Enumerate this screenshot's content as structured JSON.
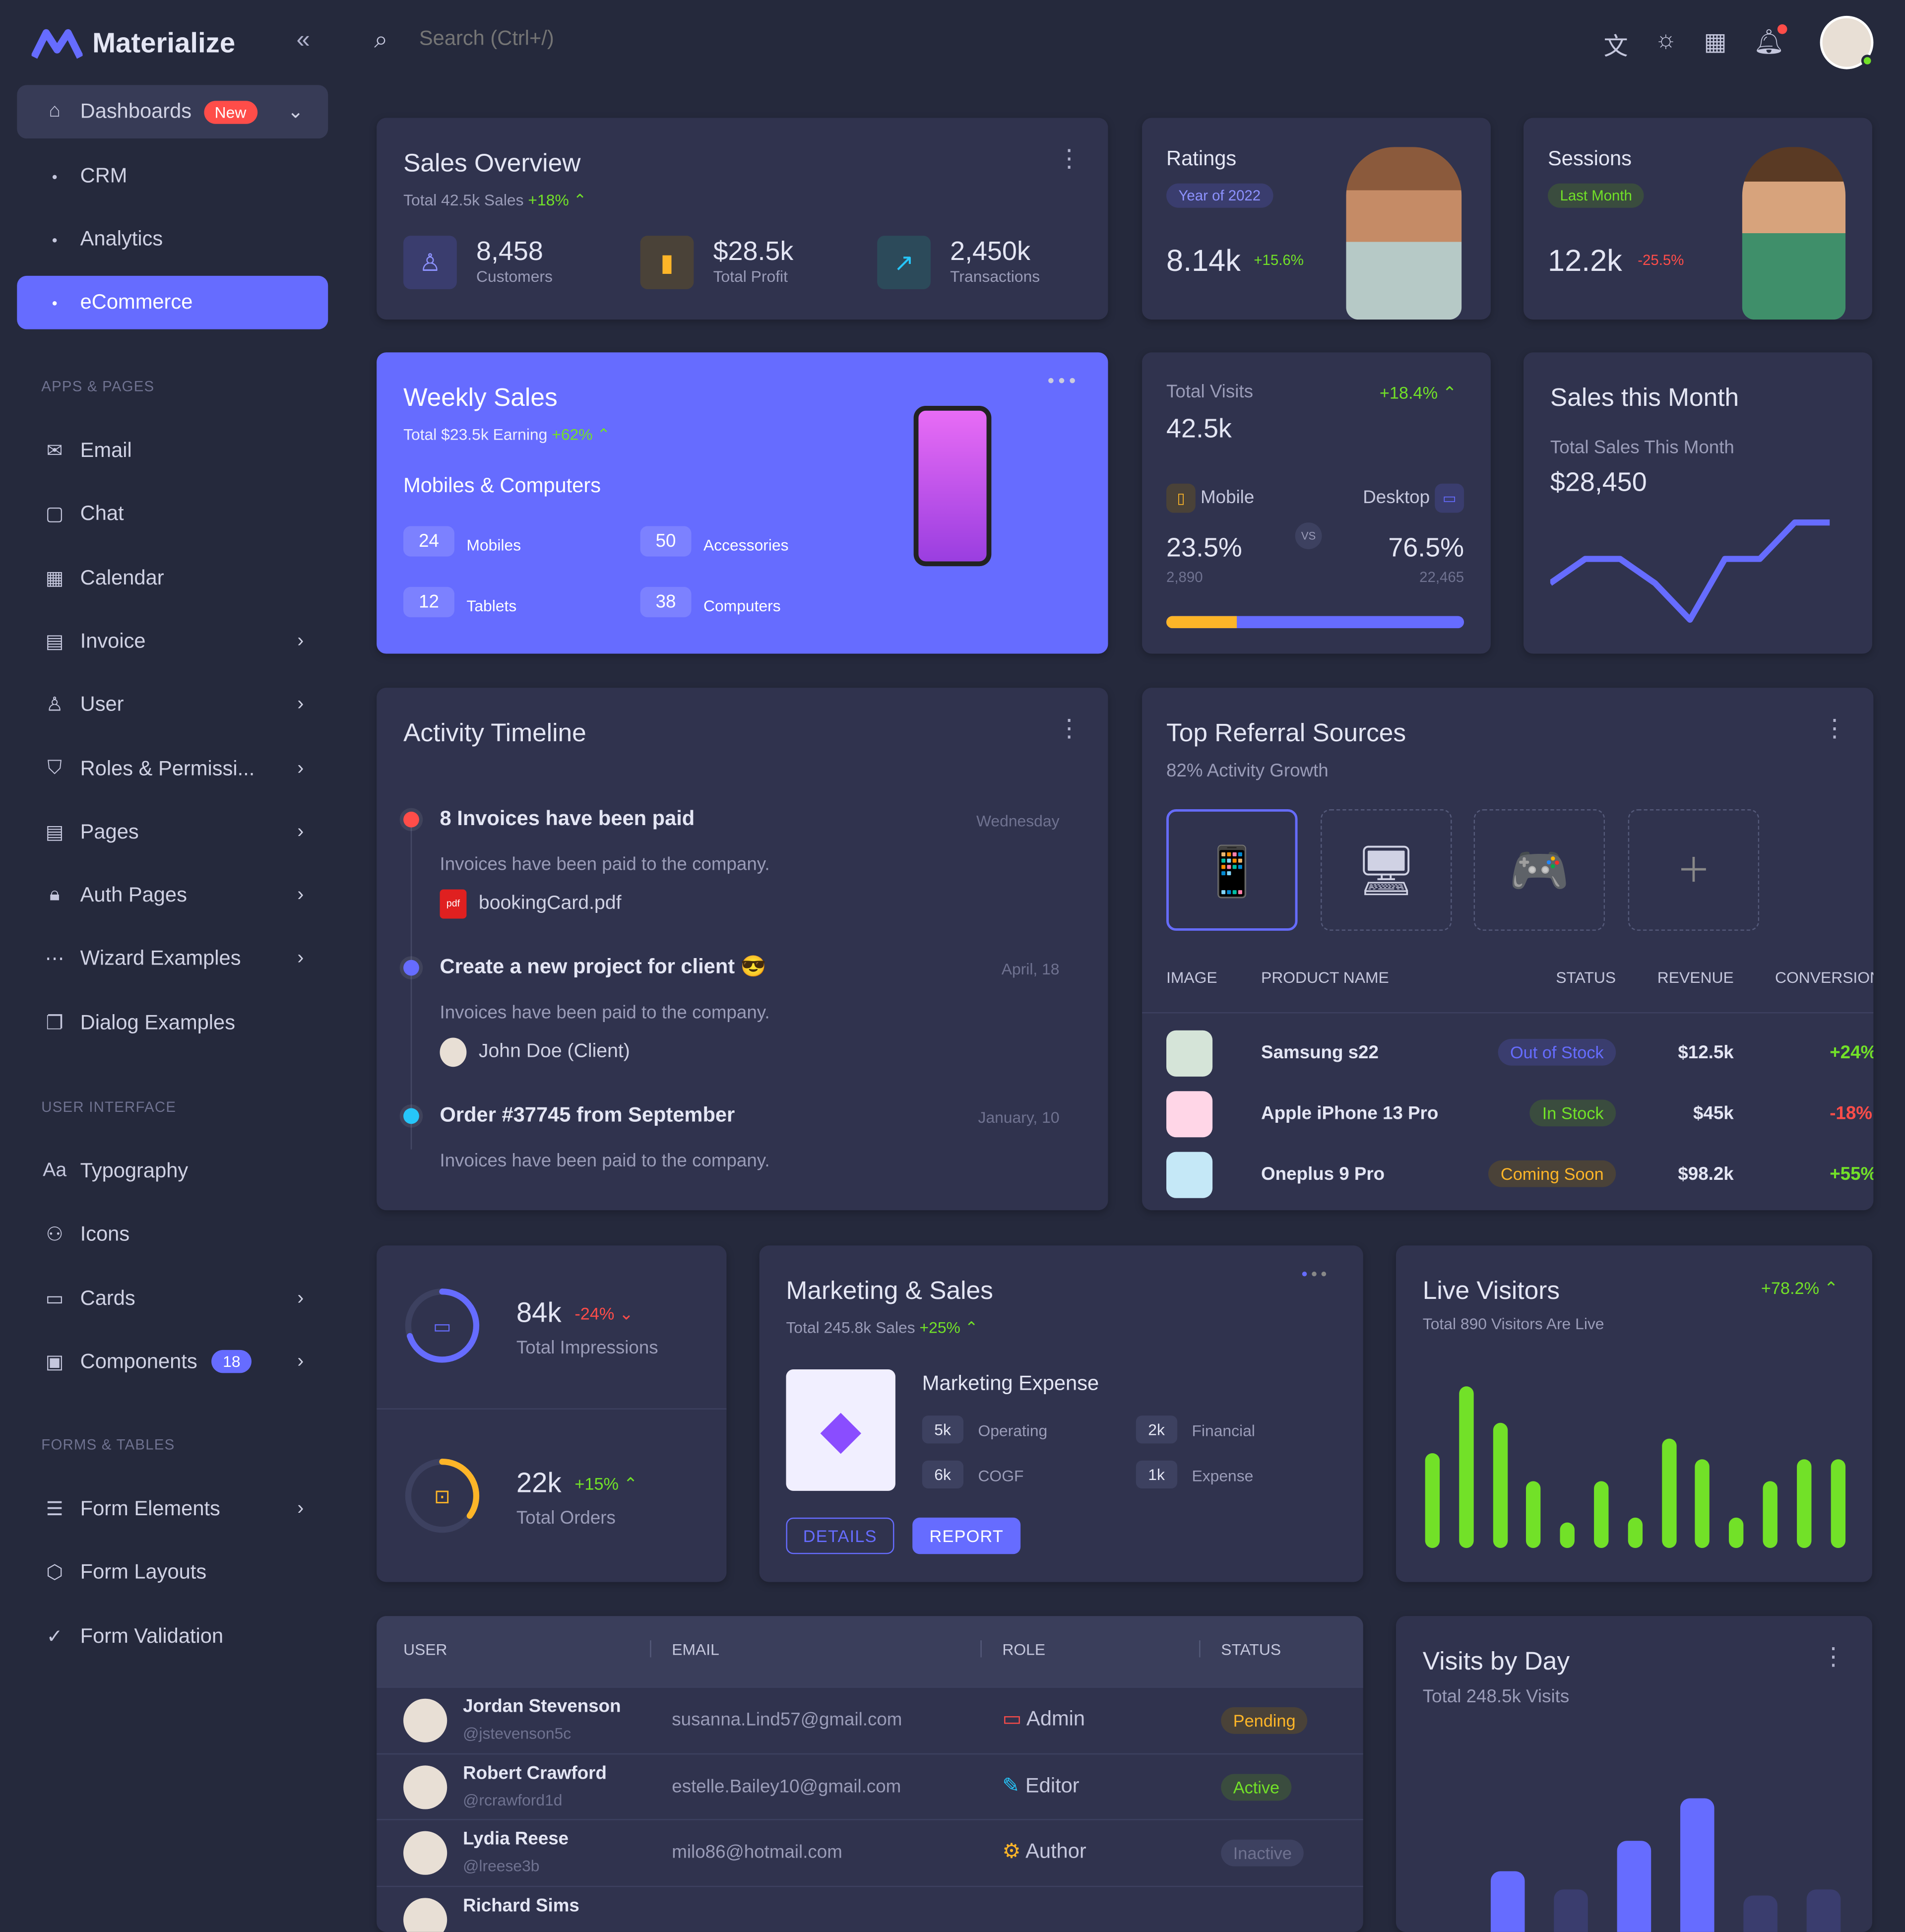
{
  "brand": {
    "name": "Materialize"
  },
  "search": {
    "placeholder": "Search (Ctrl+/)"
  },
  "sidebar": {
    "dashboards": {
      "label": "Dashboards",
      "badge": "New"
    },
    "sub": [
      {
        "label": "CRM"
      },
      {
        "label": "Analytics"
      },
      {
        "label": "eCommerce"
      }
    ],
    "sections": [
      "APPS & PAGES",
      "USER INTERFACE",
      "FORMS & TABLES"
    ],
    "apps": [
      {
        "label": "Email",
        "icon": "mail-icon"
      },
      {
        "label": "Chat",
        "icon": "chat-icon"
      },
      {
        "label": "Calendar",
        "icon": "calendar-icon"
      },
      {
        "label": "Invoice",
        "icon": "file-icon"
      },
      {
        "label": "User",
        "icon": "user-icon"
      },
      {
        "label": "Roles & Permissi...",
        "icon": "shield-icon"
      },
      {
        "label": "Pages",
        "icon": "file-icon"
      },
      {
        "label": "Auth Pages",
        "icon": "lock-icon"
      },
      {
        "label": "Wizard Examples",
        "icon": "wizard-icon"
      },
      {
        "label": "Dialog Examples",
        "icon": "copy-icon"
      }
    ],
    "ui": [
      {
        "label": "Typography",
        "icon": "typography-icon"
      },
      {
        "label": "Icons",
        "icon": "shapes-icon"
      },
      {
        "label": "Cards",
        "icon": "card-icon"
      },
      {
        "label": "Components",
        "icon": "archive-icon",
        "badge": "18"
      }
    ],
    "forms": [
      {
        "label": "Form Elements",
        "icon": "form-icon"
      },
      {
        "label": "Form Layouts",
        "icon": "cube-icon"
      },
      {
        "label": "Form Validation",
        "icon": "check-circle-icon"
      }
    ]
  },
  "colors": {
    "primary": "#666cff",
    "success": "#72e128",
    "danger": "#ff4d49",
    "warning": "#fdb528",
    "info": "#26c6f9"
  },
  "sales_overview": {
    "title": "Sales Overview",
    "subtitle": "Total 42.5k Sales",
    "change": "+18%",
    "stats": [
      {
        "value": "8,458",
        "label": "Customers"
      },
      {
        "value": "$28.5k",
        "label": "Total Profit"
      },
      {
        "value": "2,450k",
        "label": "Transactions"
      }
    ]
  },
  "ratings": {
    "title": "Ratings",
    "chip": "Year of 2022",
    "value": "8.14k",
    "change": "+15.6%"
  },
  "sessions": {
    "title": "Sessions",
    "chip": "Last Month",
    "value": "12.2k",
    "change": "-25.5%"
  },
  "weekly": {
    "title": "Weekly Sales",
    "subtitle": "Total $23.5k Earning",
    "change": "+62%",
    "heading": "Mobiles & Computers",
    "items": [
      {
        "value": "24",
        "label": "Mobiles"
      },
      {
        "value": "50",
        "label": "Accessories"
      },
      {
        "value": "12",
        "label": "Tablets"
      },
      {
        "value": "38",
        "label": "Computers"
      }
    ]
  },
  "visits": {
    "title": "Total Visits",
    "change": "+18.4%",
    "value": "42.5k",
    "mobile": {
      "label": "Mobile",
      "pct": "23.5%",
      "count": "2,890"
    },
    "desktop": {
      "label": "Desktop",
      "pct": "76.5%",
      "count": "22,465"
    },
    "vs": "VS",
    "mobile_fraction": 0.235
  },
  "sales_month": {
    "title": "Sales this Month",
    "subtitle": "Total Sales This Month",
    "value": "$28,450",
    "line": [
      3,
      5,
      5,
      3,
      0,
      5,
      5,
      8,
      8
    ]
  },
  "timeline": {
    "title": "Activity Timeline",
    "items": [
      {
        "title": "8 Invoices have been paid",
        "date": "Wednesday",
        "desc": "Invoices have been paid to the company.",
        "attach": "bookingCard.pdf",
        "color": "#ff4d49"
      },
      {
        "title": "Create a new project for client 😎",
        "date": "April, 18",
        "desc": "Invoices have been paid to the company.",
        "attach": "John Doe (Client)",
        "color": "#666cff"
      },
      {
        "title": "Order #37745 from September",
        "date": "January, 10",
        "desc": "Invoices have been paid to the company.",
        "color": "#26c6f9"
      }
    ]
  },
  "referral": {
    "title": "Top Referral Sources",
    "subtitle": "82% Activity Growth",
    "headers": [
      "IMAGE",
      "PRODUCT NAME",
      "STATUS",
      "REVENUE",
      "CONVERSION"
    ],
    "rows": [
      {
        "name": "Samsung s22",
        "status": "Out of Stock",
        "revenue": "$12.5k",
        "conv": "+24%",
        "sc": "p",
        "cc": "g",
        "bg": "#d5e4d8"
      },
      {
        "name": "Apple iPhone 13 Pro",
        "status": "In Stock",
        "revenue": "$45k",
        "conv": "-18%",
        "sc": "g",
        "cc": "r",
        "bg": "#ffd6e7"
      },
      {
        "name": "Oneplus 9 Pro",
        "status": "Coming Soon",
        "revenue": "$98.2k",
        "conv": "+55%",
        "sc": "o",
        "cc": "g",
        "bg": "#c5e8f7"
      }
    ]
  },
  "impressions": {
    "value": "84k",
    "change": "-24%",
    "label": "Total Impressions",
    "progress": 0.7
  },
  "orders": {
    "value": "22k",
    "change": "+15%",
    "label": "Total Orders",
    "progress": 0.35
  },
  "marketing": {
    "title": "Marketing & Sales",
    "subtitle": "Total 245.8k Sales",
    "change": "+25%",
    "heading": "Marketing Expense",
    "items": [
      {
        "value": "5k",
        "label": "Operating"
      },
      {
        "value": "2k",
        "label": "Financial"
      },
      {
        "value": "6k",
        "label": "COGF"
      },
      {
        "value": "1k",
        "label": "Expense"
      }
    ],
    "details": "DETAILS",
    "report": "REPORT"
  },
  "live": {
    "title": "Live Visitors",
    "subtitle": "Total 890 Visitors Are Live",
    "change": "+78.2%",
    "bars": [
      78,
      133,
      103,
      55,
      21,
      55,
      25,
      90,
      73,
      25,
      55,
      73,
      73
    ]
  },
  "users": {
    "headers": [
      "USER",
      "EMAIL",
      "ROLE",
      "STATUS"
    ],
    "rows": [
      {
        "name": "Jordan Stevenson",
        "handle": "@jstevenson5c",
        "email": "susanna.Lind57@gmail.com",
        "role": "Admin",
        "status": "Pending",
        "rc": "#ff4d49",
        "sc": "o"
      },
      {
        "name": "Robert Crawford",
        "handle": "@rcrawford1d",
        "email": "estelle.Bailey10@gmail.com",
        "role": "Editor",
        "status": "Active",
        "rc": "#26c6f9",
        "sc": "g"
      },
      {
        "name": "Lydia Reese",
        "handle": "@lreese3b",
        "email": "milo86@hotmail.com",
        "role": "Author",
        "status": "Inactive",
        "rc": "#fdb528",
        "sc": "i"
      },
      {
        "name": "Richard Sims"
      }
    ]
  },
  "visits_day": {
    "title": "Visits by Day",
    "subtitle": "Total 248.5k Visits",
    "bars": [
      60,
      45,
      85,
      120,
      40,
      45
    ]
  }
}
